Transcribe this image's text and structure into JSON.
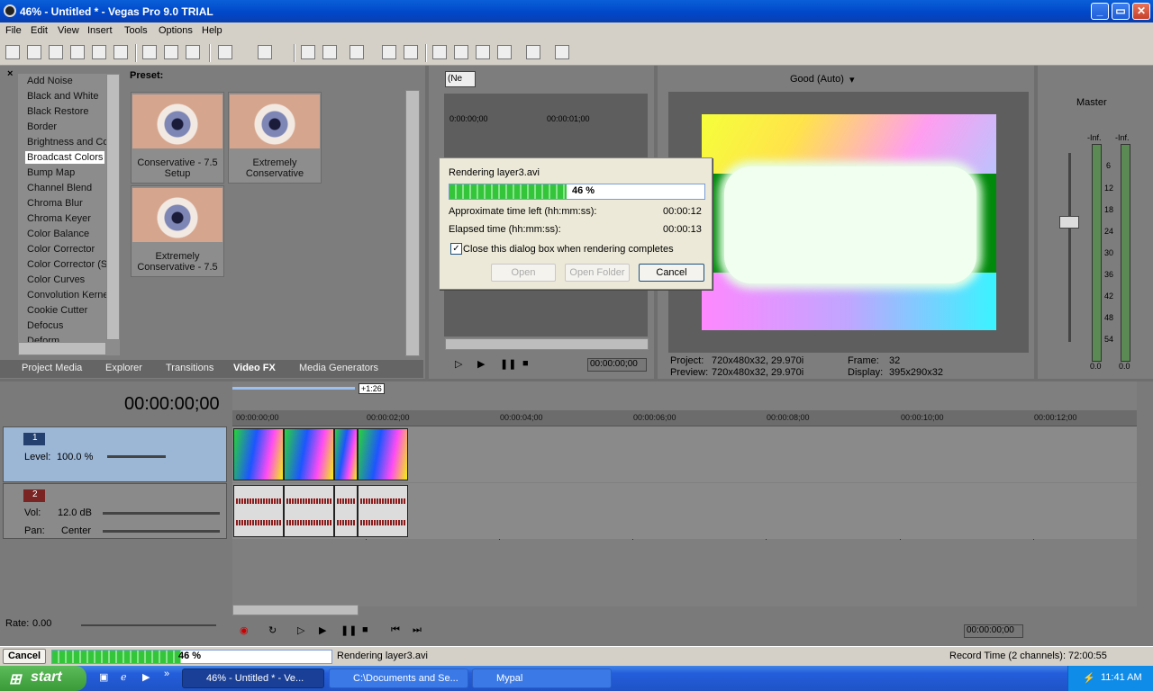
{
  "window": {
    "title": "46% - Untitled * - Vegas Pro 9.0 TRIAL",
    "controls": [
      "_",
      "▭",
      "✕"
    ]
  },
  "menu": [
    "File",
    "Edit",
    "View",
    "Insert",
    "Tools",
    "Options",
    "Help"
  ],
  "fx_panel": {
    "items": [
      "Add Noise",
      "Black and White",
      "Black Restore",
      "Border",
      "Brightness and Co",
      "Broadcast Colors",
      "Bump Map",
      "Channel Blend",
      "Chroma Blur",
      "Chroma Keyer",
      "Color Balance",
      "Color Corrector",
      "Color Corrector (S",
      "Color Curves",
      "Convolution Kerne",
      "Cookie Cutter",
      "Defocus",
      "Deform"
    ],
    "selected": "Broadcast Colors",
    "preset_label": "Preset:",
    "presets": [
      "Conservative - 7.5 Setup",
      "Extremely Conservative",
      "Extremely Conservative - 7.5"
    ]
  },
  "tabs": [
    "Project Media",
    "Explorer",
    "Transitions",
    "Video FX",
    "Media Generators"
  ],
  "active_tab": "Video FX",
  "trimmer": {
    "dropdown": "(Ne",
    "ruler": [
      "0:00:00;00",
      "00:00:01;00"
    ],
    "timecode": "00:00:00;00"
  },
  "preview": {
    "quality": "Good (Auto)",
    "project_label": "Project:",
    "project": "720x480x32, 29.970i",
    "preview_label": "Preview:",
    "preview": "720x480x32, 29.970i",
    "frame_label": "Frame:",
    "frame": "32",
    "display_label": "Display:",
    "display": "395x290x32"
  },
  "mixer": {
    "title": "Master",
    "left_peak": "-Inf.",
    "right_peak": "-Inf.",
    "scale": [
      "6",
      "12",
      "18",
      "24",
      "30",
      "36",
      "42",
      "48",
      "54"
    ],
    "left_val": "0.0",
    "right_val": "0.0"
  },
  "dialog": {
    "title": "Rendering layer3.avi",
    "progress_percent": 46,
    "progress_text": "46 %",
    "time_left_label": "Approximate time left (hh:mm:ss):",
    "time_left": "00:00:12",
    "elapsed_label": "Elapsed time (hh:mm:ss):",
    "elapsed": "00:00:13",
    "checkbox_label": "Close this dialog box when rendering completes",
    "checkbox_checked": true,
    "open_label": "Open",
    "open_folder_label": "Open Folder",
    "cancel_label": "Cancel"
  },
  "timeline": {
    "main_timecode": "00:00:00;00",
    "loop_marker": "+1:26",
    "ruler": [
      "00:00:00;00",
      "00:00:02;00",
      "00:00:04;00",
      "00:00:06;00",
      "00:00:08;00",
      "00:00:10;00",
      "00:00:12;00"
    ],
    "tracks": [
      {
        "num": "1",
        "type": "video",
        "level_label": "Level:",
        "level": "100.0 %"
      },
      {
        "num": "2",
        "type": "audio",
        "vol_label": "Vol:",
        "vol": "12.0 dB",
        "pan_label": "Pan:",
        "pan": "Center"
      }
    ],
    "rate_label": "Rate:",
    "rate": "0.00",
    "end_timecode": "00:00:00;00"
  },
  "status": {
    "cancel_label": "Cancel",
    "progress_text": "46 %",
    "progress_percent": 46,
    "message": "Rendering layer3.avi",
    "record_time": "Record Time (2 channels): 72:00:55"
  },
  "taskbar": {
    "start_label": "start",
    "tasks": [
      "46% - Untitled * - Ve...",
      "C:\\Documents and Se...",
      "Mypal"
    ],
    "clock": "11:41 AM"
  }
}
